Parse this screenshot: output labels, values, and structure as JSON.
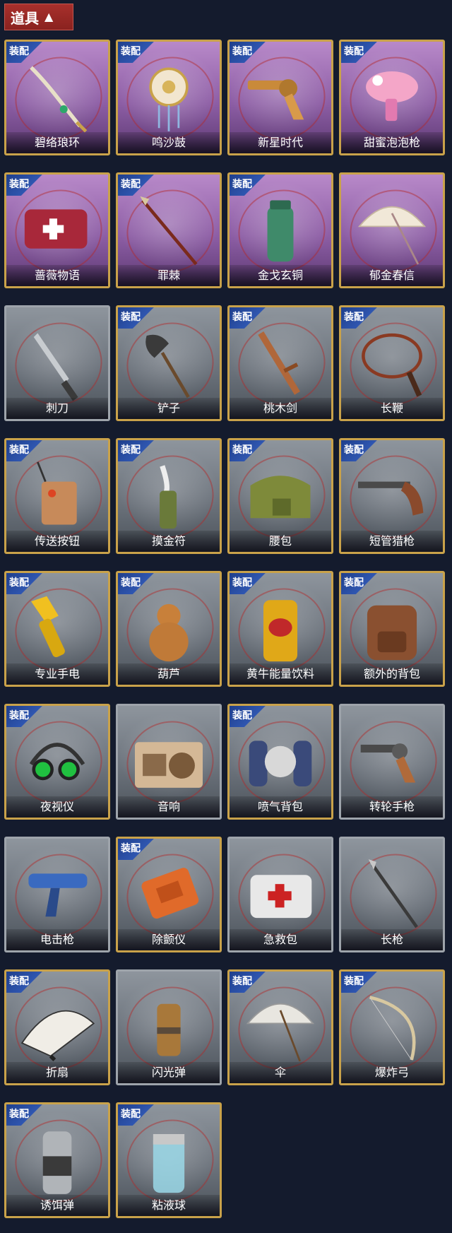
{
  "header": {
    "title": "道具",
    "toggle_icon": "chevron-up-icon"
  },
  "badge_text": "装配",
  "items": [
    {
      "name": "碧络琅环",
      "equipped": true,
      "rarity": "purple",
      "icon": "jade-sword-icon"
    },
    {
      "name": "鸣沙鼓",
      "equipped": true,
      "rarity": "purple",
      "icon": "drum-icon"
    },
    {
      "name": "新星时代",
      "equipped": true,
      "rarity": "purple",
      "icon": "revolver-icon"
    },
    {
      "name": "甜蜜泡泡枪",
      "equipped": true,
      "rarity": "purple",
      "icon": "bubble-gun-icon"
    },
    {
      "name": "蔷薇物语",
      "equipped": true,
      "rarity": "purple",
      "icon": "medkit-icon"
    },
    {
      "name": "罪棘",
      "equipped": true,
      "rarity": "purple",
      "icon": "spear-icon"
    },
    {
      "name": "金戈玄铜",
      "equipped": true,
      "rarity": "purple",
      "icon": "bronze-canister-icon"
    },
    {
      "name": "郁金春信",
      "equipped": false,
      "rarity": "purple",
      "icon": "parasol-icon"
    },
    {
      "name": "刺刀",
      "equipped": false,
      "rarity": "gray",
      "icon": "knife-icon"
    },
    {
      "name": "铲子",
      "equipped": true,
      "rarity": "gray",
      "icon": "shovel-icon"
    },
    {
      "name": "桃木剑",
      "equipped": true,
      "rarity": "gray",
      "icon": "wooden-sword-icon"
    },
    {
      "name": "长鞭",
      "equipped": true,
      "rarity": "gray",
      "icon": "whip-icon"
    },
    {
      "name": "传送按钮",
      "equipped": true,
      "rarity": "gray",
      "icon": "remote-icon"
    },
    {
      "name": "摸金符",
      "equipped": true,
      "rarity": "gray",
      "icon": "amulet-icon"
    },
    {
      "name": "腰包",
      "equipped": true,
      "rarity": "gray",
      "icon": "bag-icon"
    },
    {
      "name": "短管猎枪",
      "equipped": true,
      "rarity": "gray",
      "icon": "shotgun-icon"
    },
    {
      "name": "专业手电",
      "equipped": true,
      "rarity": "gray",
      "icon": "flashlight-icon"
    },
    {
      "name": "葫芦",
      "equipped": true,
      "rarity": "gray",
      "icon": "gourd-icon"
    },
    {
      "name": "黄牛能量饮料",
      "equipped": true,
      "rarity": "gray",
      "icon": "can-icon"
    },
    {
      "name": "额外的背包",
      "equipped": true,
      "rarity": "gray",
      "icon": "backpack-icon"
    },
    {
      "name": "夜视仪",
      "equipped": true,
      "rarity": "gray",
      "icon": "goggles-icon"
    },
    {
      "name": "音响",
      "equipped": false,
      "rarity": "gray",
      "icon": "radio-icon"
    },
    {
      "name": "喷气背包",
      "equipped": true,
      "rarity": "gray",
      "icon": "jetpack-icon"
    },
    {
      "name": "转轮手枪",
      "equipped": false,
      "rarity": "gray",
      "icon": "pistol-icon"
    },
    {
      "name": "电击枪",
      "equipped": false,
      "rarity": "gray",
      "icon": "taser-icon"
    },
    {
      "name": "除颤仪",
      "equipped": true,
      "rarity": "gray",
      "icon": "defibrillator-icon"
    },
    {
      "name": "急救包",
      "equipped": false,
      "rarity": "gray",
      "icon": "first-aid-icon"
    },
    {
      "name": "长枪",
      "equipped": false,
      "rarity": "gray",
      "icon": "lance-icon"
    },
    {
      "name": "折扇",
      "equipped": true,
      "rarity": "gray",
      "icon": "fan-icon"
    },
    {
      "name": "闪光弹",
      "equipped": false,
      "rarity": "gray",
      "icon": "flashbang-icon"
    },
    {
      "name": "伞",
      "equipped": true,
      "rarity": "gray",
      "icon": "umbrella-icon"
    },
    {
      "name": "爆炸弓",
      "equipped": true,
      "rarity": "gray",
      "icon": "bow-icon"
    },
    {
      "name": "诱饵弹",
      "equipped": true,
      "rarity": "gray",
      "icon": "decoy-icon"
    },
    {
      "name": "粘液球",
      "equipped": true,
      "rarity": "gray",
      "icon": "slime-icon"
    }
  ]
}
